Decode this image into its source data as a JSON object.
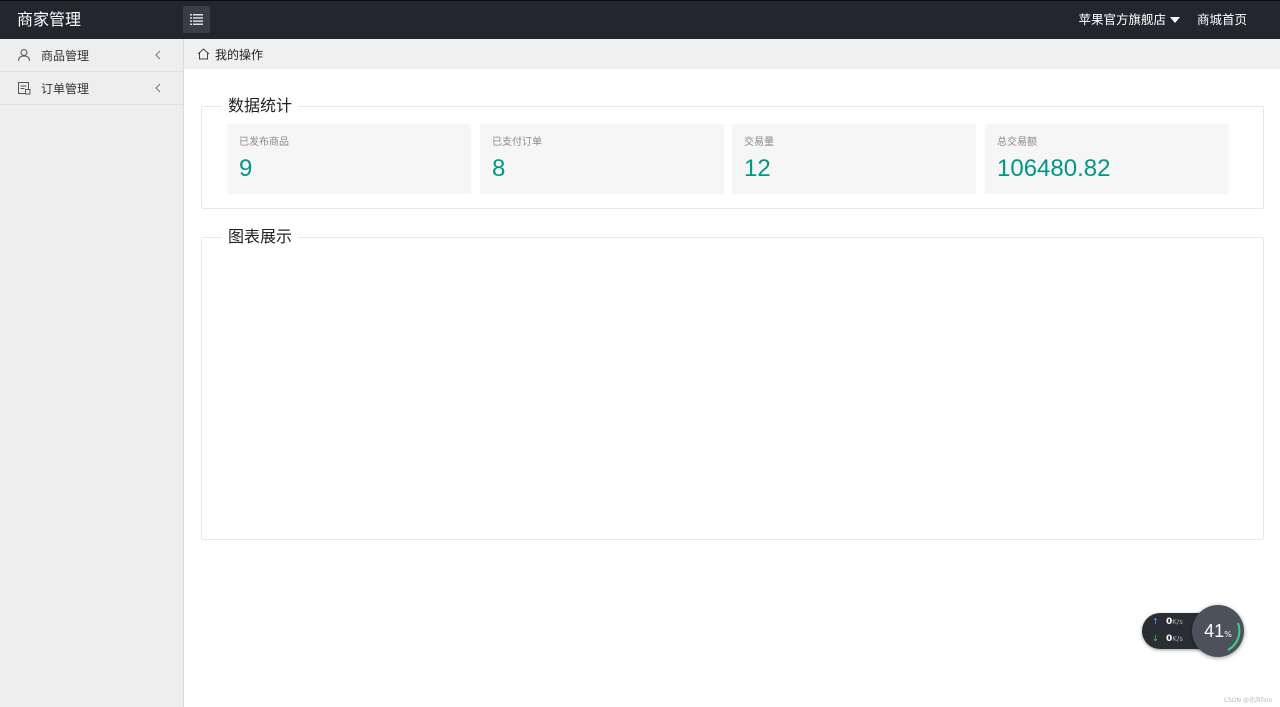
{
  "header": {
    "logo": "商家管理",
    "store_name": "苹果官方旗舰店",
    "home_link": "商城首页"
  },
  "sidebar": {
    "items": [
      {
        "label": "商品管理",
        "icon": "user-icon"
      },
      {
        "label": "订单管理",
        "icon": "order-icon"
      }
    ]
  },
  "breadcrumb": {
    "label": "我的操作",
    "icon": "home-icon"
  },
  "stats": {
    "title": "数据统计",
    "cards": [
      {
        "label": "已发布商品",
        "value": "9"
      },
      {
        "label": "已支付订单",
        "value": "8"
      },
      {
        "label": "交易量",
        "value": "12"
      },
      {
        "label": "总交易额",
        "value": "106480.82"
      }
    ]
  },
  "charts": {
    "title": "图表展示"
  },
  "speed_widget": {
    "up": "0",
    "down": "0",
    "unit": "K/s",
    "percent": "41",
    "percent_unit": "%"
  },
  "watermark": "CSDN @北风feio",
  "colors": {
    "header_bg": "#23262e",
    "accent": "#009688",
    "sidebar_bg": "#eeeeee"
  }
}
